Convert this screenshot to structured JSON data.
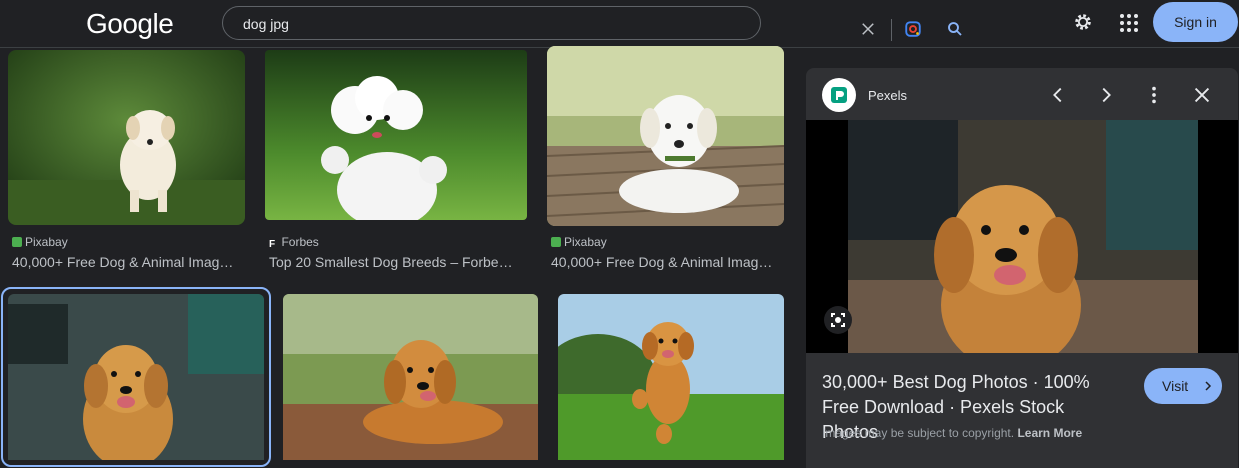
{
  "header": {
    "logo": "Google",
    "search_value": "dog jpg",
    "signin_label": "Sign in"
  },
  "results": [
    {
      "source": "Pixabay",
      "title": "40,000+ Free Dog & Animal Imag…",
      "favicon_color": "#4caf50",
      "favicon_text": "px"
    },
    {
      "source": "Forbes",
      "title": "Top 20 Smallest Dog Breeds – Forbe…",
      "favicon_color": "#ffffff",
      "favicon_text": "F"
    },
    {
      "source": "Pixabay",
      "title": "40,000+ Free Dog & Animal Imag…",
      "favicon_color": "#4caf50",
      "favicon_text": "px"
    }
  ],
  "panel": {
    "source": "Pexels",
    "title": "30,000+ Best Dog Photos · 100% Free Download · Pexels Stock Photos",
    "visit_label": "Visit",
    "copyright_text": "Images may be subject to copyright.",
    "learn_more": "Learn More"
  },
  "colors": {
    "background": "#202124",
    "accent": "#8ab4f8",
    "panel": "#303134"
  }
}
